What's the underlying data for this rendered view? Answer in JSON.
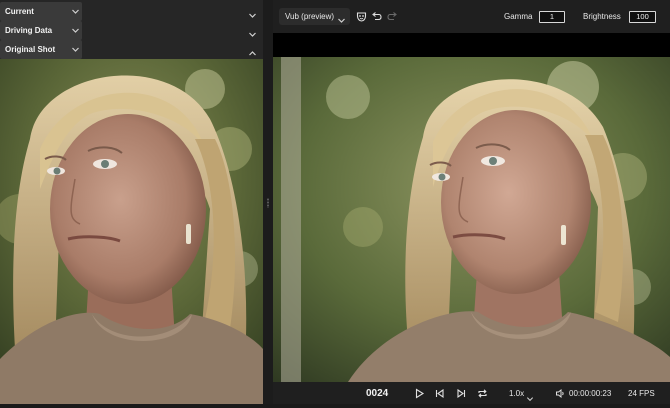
{
  "panels": {
    "current": {
      "label": "Current",
      "icon": "chevron-down-icon"
    },
    "driving_data": {
      "label": "Driving Data",
      "icon": "chevron-down-icon"
    },
    "original_shot": {
      "label": "Original Shot",
      "icon": "chevron-up-icon"
    }
  },
  "toolbar": {
    "model_select": "Vub (preview)",
    "mask_icon": "mask-icon",
    "undo_icon": "undo-icon",
    "redo_icon": "redo-icon",
    "gamma_label": "Gamma",
    "gamma_value": "1",
    "brightness_label": "Brightness",
    "brightness_value": "100"
  },
  "playback": {
    "frame": "0024",
    "speed": "1.0x",
    "timecode": "00:00:00:23",
    "fps": "24 FPS",
    "icons": [
      "play-icon",
      "step-back-icon",
      "step-forward-icon",
      "loop-icon",
      "volume-icon"
    ]
  },
  "colors": {
    "panel_bg": "#262626",
    "toolbar_bg": "#1f1f1f",
    "text": "#e6e6e6"
  }
}
